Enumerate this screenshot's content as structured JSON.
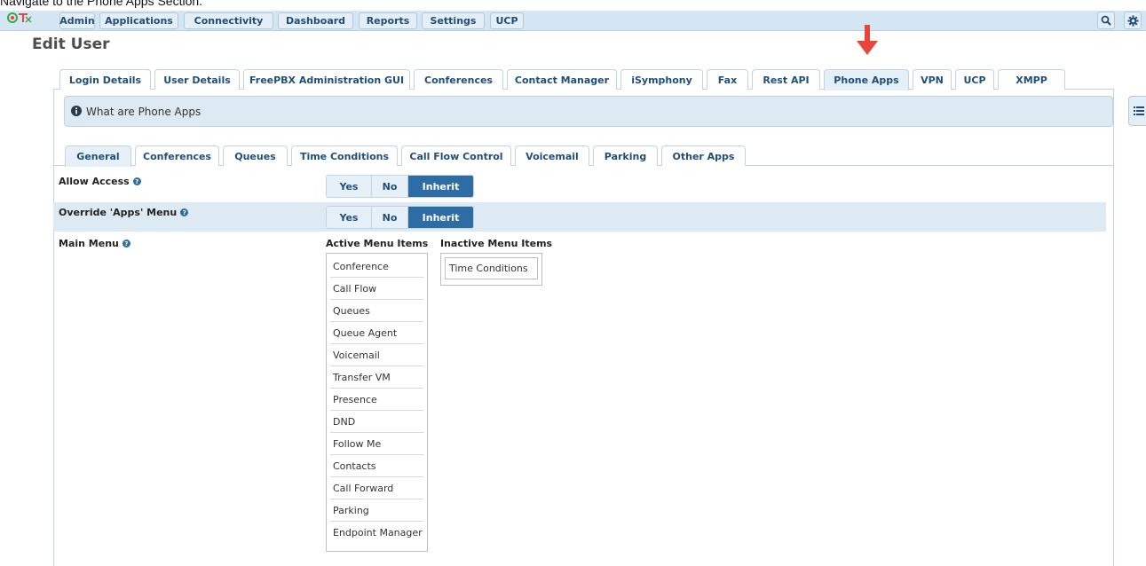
{
  "caption": "Navigate to the Phone Apps Section.",
  "nav": {
    "items": [
      "Admin",
      "Applications",
      "Connectivity",
      "Dashboard",
      "Reports",
      "Settings",
      "UCP"
    ],
    "search_icon": "search-icon",
    "settings_icon": "gear-icon"
  },
  "page_title": "Edit User",
  "tabs": [
    "Login Details",
    "User Details",
    "FreePBX Administration GUI",
    "Conferences",
    "Contact Manager",
    "iSymphony",
    "Fax",
    "Rest API",
    "Phone Apps",
    "VPN",
    "UCP",
    "XMPP"
  ],
  "active_tab": "Phone Apps",
  "info_box": "What are Phone Apps",
  "subtabs": [
    "General",
    "Conferences",
    "Queues",
    "Time Conditions",
    "Call Flow Control",
    "Voicemail",
    "Parking",
    "Other Apps"
  ],
  "active_subtab": "General",
  "form": {
    "allow_access": {
      "label": "Allow Access",
      "options": [
        "Yes",
        "No",
        "Inherit"
      ],
      "selected": "Inherit"
    },
    "override_menu": {
      "label": "Override 'Apps' Menu",
      "options": [
        "Yes",
        "No",
        "Inherit"
      ],
      "selected": "Inherit"
    },
    "main_menu": {
      "label": "Main Menu",
      "active_heading": "Active Menu Items",
      "inactive_heading": "Inactive Menu Items",
      "active_items": [
        "Conference",
        "Call Flow",
        "Queues",
        "Queue Agent",
        "Voicemail",
        "Transfer VM",
        "Presence",
        "DND",
        "Follow Me",
        "Contacts",
        "Call Forward",
        "Parking",
        "Endpoint Manager"
      ],
      "inactive_items": [
        "Time Conditions"
      ]
    }
  },
  "colors": {
    "accent": "#2e6da4",
    "navbar": "#d4e6f3",
    "arrow": "#e8453c"
  }
}
